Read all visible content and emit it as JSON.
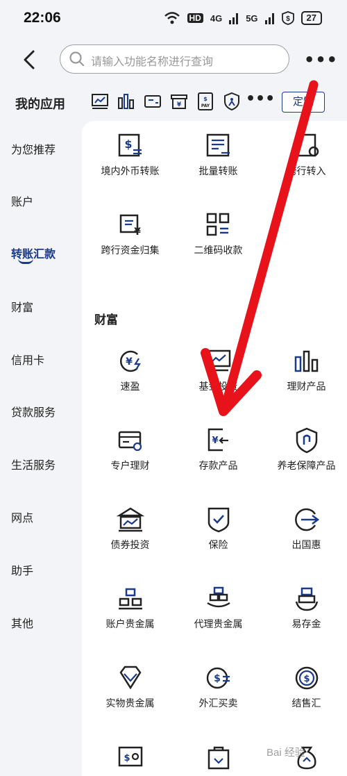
{
  "status_bar": {
    "time": "22:06",
    "network_1": "4G",
    "network_2": "5G",
    "hd_label": "HD",
    "battery": "27"
  },
  "header": {
    "search_placeholder": "请输入功能名称进行查询"
  },
  "my_apps": {
    "title": "我的应用",
    "custom_button": "定制"
  },
  "sidebar": {
    "items": [
      "为您推荐",
      "账户",
      "转账汇款",
      "财富",
      "信用卡",
      "贷款服务",
      "生活服务",
      "网点",
      "助手",
      "其他"
    ],
    "active": "转账汇款"
  },
  "transfer": {
    "items": [
      "境内外币转账",
      "批量转账",
      "跨行转入",
      "跨行资金归集",
      "二维码收款"
    ]
  },
  "wealth": {
    "title": "财富",
    "items": [
      "速盈",
      "基金投资",
      "理财产品",
      "专户理财",
      "存款产品",
      "养老保障产品",
      "债券投资",
      "保险",
      "出国惠",
      "账户贵金属",
      "代理贵金属",
      "易存金",
      "实物贵金属",
      "外汇买卖",
      "结售汇"
    ]
  },
  "watermark": "Bai 经验",
  "colors": {
    "accent": "#1a3a8a",
    "background": "#f3f4f7",
    "arrow": "#e8121a"
  }
}
